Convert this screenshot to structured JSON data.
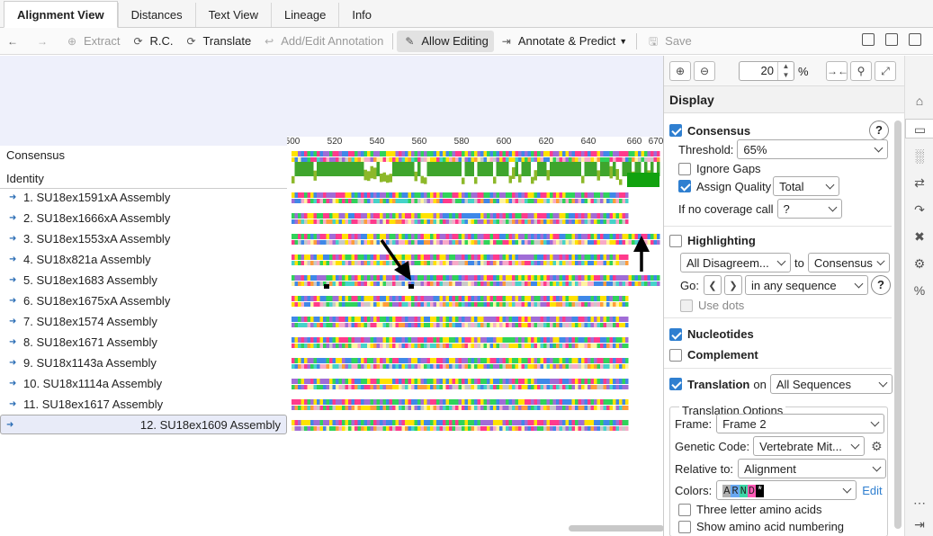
{
  "tabs": [
    {
      "label": "Alignment View",
      "active": true
    },
    {
      "label": "Distances"
    },
    {
      "label": "Text View"
    },
    {
      "label": "Lineage"
    },
    {
      "label": "Info"
    }
  ],
  "toolbar": {
    "extract": "Extract",
    "rc": "R.C.",
    "translate": "Translate",
    "add_edit": "Add/Edit Annotation",
    "allow_editing": "Allow Editing",
    "annotate": "Annotate & Predict",
    "save": "Save"
  },
  "tracks": {
    "consensus": "Consensus",
    "identity": "Identity"
  },
  "ruler": {
    "ticks": [
      "500",
      "520",
      "540",
      "560",
      "580",
      "600",
      "620",
      "640",
      "660",
      "670"
    ]
  },
  "sequences": [
    "1. SU18ex1591xA Assembly",
    "2. SU18ex1666xA Assembly",
    "3. SU18ex1553xA Assembly",
    "4. SU18x821a Assembly",
    "5. SU18ex1683 Assembly",
    "6. SU18ex1675xA Assembly",
    "7. SU18ex1574 Assembly",
    "8. SU18ex1671 Assembly",
    "9. SU18x1143a Assembly",
    "10. SU18x1114a Assembly",
    "11. SU18ex1617 Assembly",
    "12. SU18ex1609 Assembly"
  ],
  "zoom": {
    "value": "20",
    "unit": "%"
  },
  "panel": {
    "title": "Display",
    "consensus": {
      "label": "Consensus",
      "threshold_label": "Threshold:",
      "threshold": "65%",
      "ignore_gaps": "Ignore Gaps",
      "assign_quality": "Assign Quality",
      "assign_quality_value": "Total",
      "no_coverage_label": "If no coverage call",
      "no_coverage_value": "?"
    },
    "highlighting": {
      "label": "Highlighting",
      "mode": "All Disagreem...",
      "to": "to",
      "target": "Consensus",
      "go_label": "Go:",
      "go_scope": "in any sequence",
      "use_dots": "Use dots"
    },
    "nucleotides": "Nucleotides",
    "complement": "Complement",
    "translation": {
      "label": "Translation",
      "on": "on",
      "on_value": "All Sequences",
      "options_title": "Translation Options",
      "frame_label": "Frame:",
      "frame": "Frame 2",
      "code_label": "Genetic Code:",
      "code": "Vertebrate Mit...",
      "relative_label": "Relative to:",
      "relative": "Alignment",
      "colors_label": "Colors:",
      "colors_sample": [
        "A",
        "R",
        "N",
        "D",
        "*"
      ],
      "edit": "Edit",
      "three_letter": "Three letter amino acids",
      "numbering": "Show amino acid numbering"
    }
  },
  "colors": {
    "A": "#ff3a8c",
    "C": "#2fd35a",
    "G": "#ffe200",
    "T": "#a06cd6",
    "N": "#c8c8c8",
    "X": "#3f88e8",
    "O": "#ff9d3a",
    "P": "#f7aac8",
    "L": "#fff3a0",
    "M": "#45d3c9",
    "accent": "#2f7fd0"
  }
}
